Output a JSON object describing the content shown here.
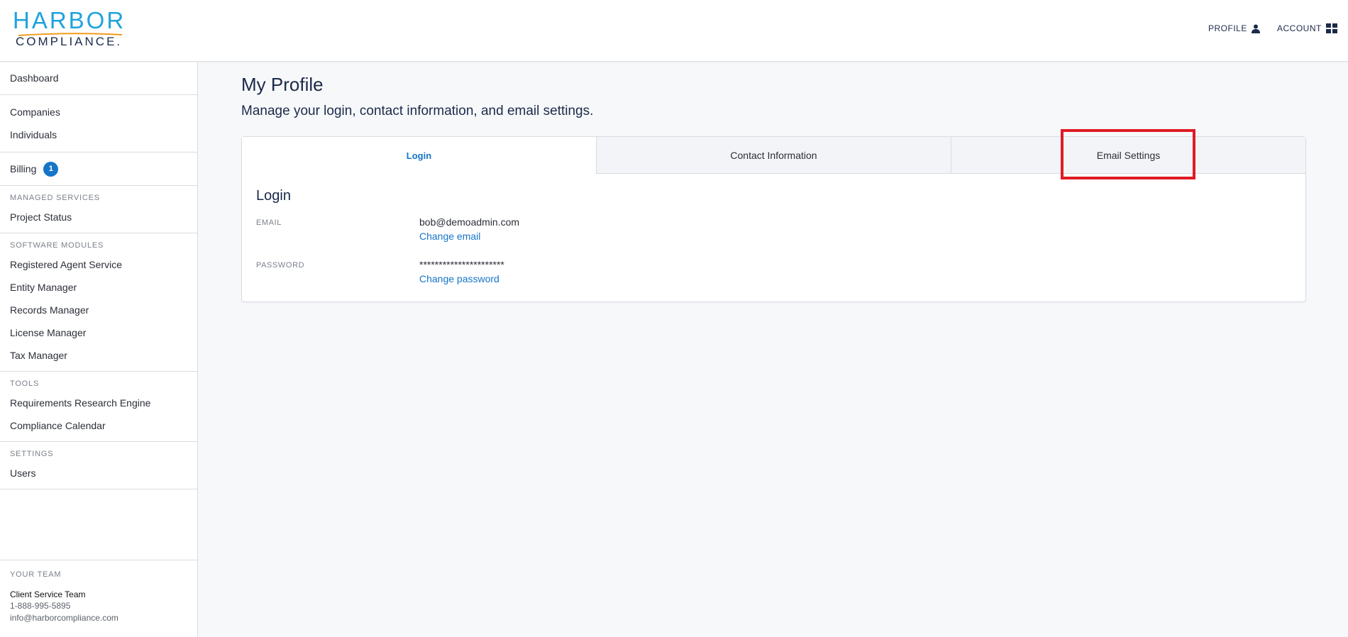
{
  "header": {
    "logo_top": "HARBOR",
    "logo_bottom": "COMPLIANCE.",
    "nav": [
      {
        "label": "PROFILE",
        "icon": "user-icon"
      },
      {
        "label": "ACCOUNT",
        "icon": "grid-icon"
      }
    ]
  },
  "sidebar": {
    "dashboard": "Dashboard",
    "companies": "Companies",
    "individuals": "Individuals",
    "billing": "Billing",
    "billing_badge": "1",
    "managed_services_heading": "MANAGED SERVICES",
    "project_status": "Project Status",
    "software_modules_heading": "SOFTWARE MODULES",
    "modules": [
      "Registered Agent Service",
      "Entity Manager",
      "Records Manager",
      "License Manager",
      "Tax Manager"
    ],
    "tools_heading": "TOOLS",
    "tools": [
      "Requirements Research Engine",
      "Compliance Calendar"
    ],
    "settings_heading": "SETTINGS",
    "users": "Users",
    "team": {
      "heading": "YOUR TEAM",
      "name": "Client Service Team",
      "phone": "1-888-995-5895",
      "email": "info@harborcompliance.com"
    }
  },
  "main": {
    "title": "My Profile",
    "subtitle": "Manage your login, contact information, and email settings.",
    "tabs": [
      "Login",
      "Contact Information",
      "Email Settings"
    ],
    "active_tab": "Login",
    "section_title": "Login",
    "email_label": "EMAIL",
    "email_value": "bob@demoadmin.com",
    "change_email": "Change email",
    "password_label": "PASSWORD",
    "password_value": "**********************",
    "change_password": "Change password"
  },
  "colors": {
    "accent": "#1575c8",
    "brand_blue": "#1fa3dc",
    "brand_navy": "#1b2a4a",
    "highlight": "#e01b24"
  }
}
